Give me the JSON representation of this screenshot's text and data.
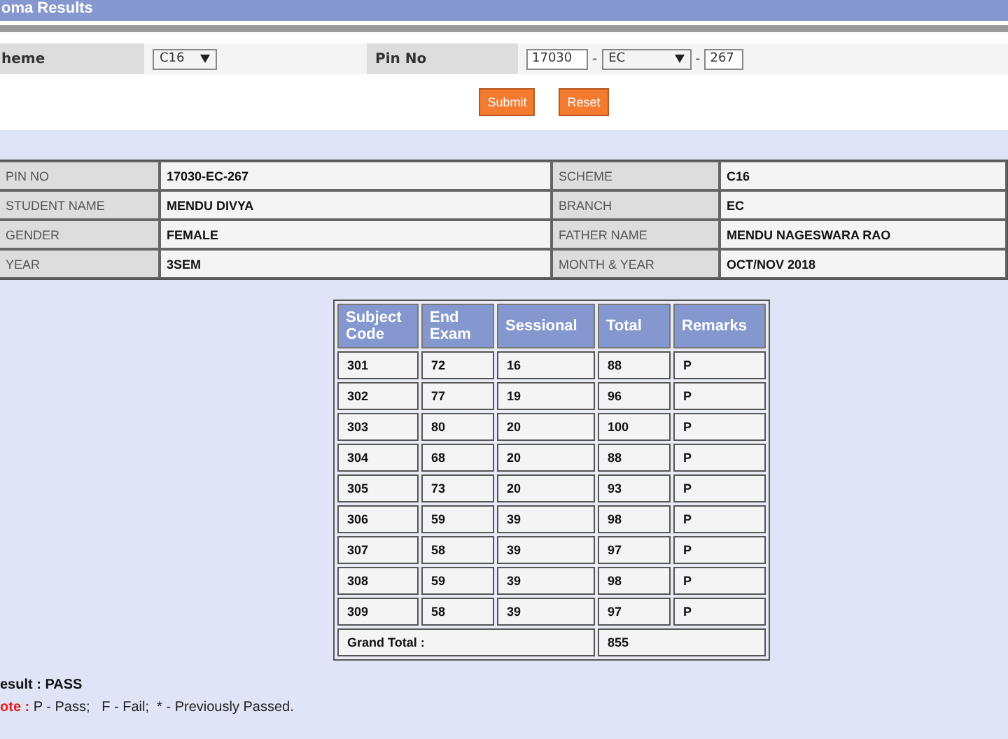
{
  "title": "oma Results",
  "form": {
    "scheme_label": "heme",
    "scheme_value": "C16",
    "pin_label": "Pin No",
    "pin_part_1": "17030",
    "pin_sep_1": "-",
    "pin_part_2": "EC",
    "pin_sep_2": "-",
    "pin_part_3": "267",
    "buttons": [
      "Submit",
      "Reset"
    ]
  },
  "student_info": [
    {
      "label_1": "PIN NO",
      "value_1": "17030-EC-267",
      "label_2": "SCHEME",
      "value_2": "C16"
    },
    {
      "label_1": "STUDENT NAME",
      "value_1": "MENDU DIVYA",
      "label_2": "BRANCH",
      "value_2": "EC"
    },
    {
      "label_1": "GENDER",
      "value_1": "FEMALE",
      "label_2": "FATHER NAME",
      "value_2": "MENDU NAGESWARA RAO"
    },
    {
      "label_1": "YEAR",
      "value_1": "3SEM",
      "label_2": "MONTH & YEAR",
      "value_2": "OCT/NOV 2018"
    }
  ],
  "marks": {
    "columns": [
      "Subject Code",
      "End Exam",
      "Sessional",
      "Total",
      "Remarks"
    ],
    "rows": [
      [
        "301",
        "72",
        "16",
        "88",
        "P"
      ],
      [
        "302",
        "77",
        "19",
        "96",
        "P"
      ],
      [
        "303",
        "80",
        "20",
        "100",
        "P"
      ],
      [
        "304",
        "68",
        "20",
        "88",
        "P"
      ],
      [
        "305",
        "73",
        "20",
        "93",
        "P"
      ],
      [
        "306",
        "59",
        "39",
        "98",
        "P"
      ],
      [
        "307",
        "58",
        "39",
        "97",
        "P"
      ],
      [
        "308",
        "59",
        "39",
        "98",
        "P"
      ],
      [
        "309",
        "58",
        "39",
        "97",
        "P"
      ]
    ],
    "grand_total_label": "Grand Total :",
    "grand_total": "855"
  },
  "result": "esult : PASS",
  "note_label": "ote :",
  "note_text": "P - Pass;   F - Fail;  * - Previously Passed."
}
